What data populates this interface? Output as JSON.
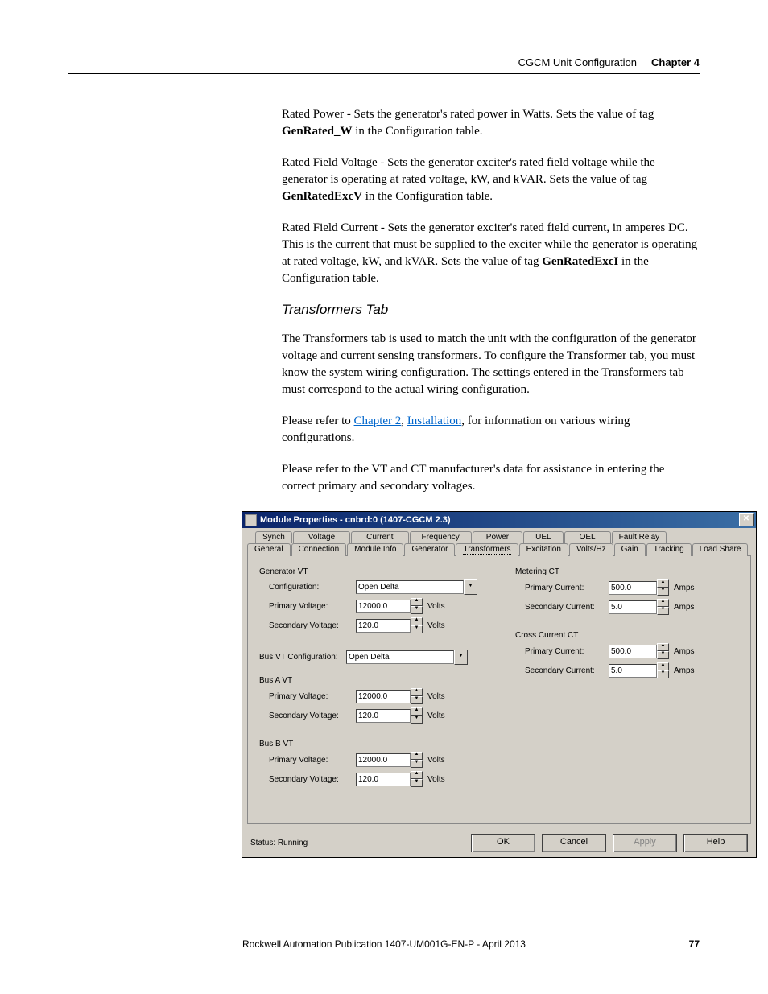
{
  "header": {
    "section": "CGCM Unit Configuration",
    "chapter": "Chapter 4"
  },
  "paragraphs": {
    "p1a": "Rated Power - Sets the generator's rated power in Watts. Sets the value of tag ",
    "p1b": "GenRated_W",
    "p1c": " in the Configuration table.",
    "p2a": "Rated Field Voltage - Sets the generator exciter's rated field voltage while the generator is operating at rated voltage, kW, and kVAR. Sets the value of tag ",
    "p2b": "GenRatedExcV",
    "p2c": " in the Configuration table.",
    "p3a": "Rated Field Current - Sets the generator exciter's rated field current, in amperes DC. This is the current that must be supplied to the exciter while the generator is operating at rated voltage, kW, and kVAR. Sets the value of tag ",
    "p3b": "GenRatedExcI",
    "p3c": " in the Configuration table.",
    "h3": "Transformers Tab",
    "p4": "The Transformers tab is used to match the unit with the configuration of the generator voltage and current sensing transformers. To configure the Transformer tab, you must know the system wiring configuration. The settings entered in the Transformers tab must correspond to the actual wiring configuration.",
    "p5a": "Please refer to ",
    "p5link1": "Chapter 2",
    "p5mid": ", ",
    "p5link2": "Installation",
    "p5b": ", for information on various wiring configurations.",
    "p6": "Please refer to the VT and CT manufacturer's data for assistance in entering the correct primary and secondary voltages."
  },
  "dialog": {
    "title": "Module Properties - cnbrd:0 (1407-CGCM 2.3)",
    "tabs_back": [
      "Synch",
      "Voltage",
      "Current",
      "Frequency",
      "Power",
      "UEL",
      "OEL",
      "Fault Relay"
    ],
    "tabs_front": [
      "General",
      "Connection",
      "Module Info",
      "Generator",
      "Transformers",
      "Excitation",
      "Volts/Hz",
      "Gain",
      "Tracking",
      "Load Share"
    ],
    "active_tab": "Transformers",
    "gen_vt_title": "Generator VT",
    "labels": {
      "configuration": "Configuration:",
      "primary_voltage": "Primary Voltage:",
      "secondary_voltage": "Secondary Voltage:",
      "bus_vt_config": "Bus VT Configuration:",
      "bus_a_vt": "Bus A VT",
      "bus_b_vt": "Bus B VT",
      "metering_ct": "Metering CT",
      "primary_current": "Primary Current:",
      "secondary_current": "Secondary Current:",
      "cross_current_ct": "Cross Current CT"
    },
    "values": {
      "gen_config": "Open Delta",
      "gen_primary_v": "12000.0",
      "gen_secondary_v": "120.0",
      "bus_vt_config": "Open Delta",
      "busA_primary_v": "12000.0",
      "busA_secondary_v": "120.0",
      "busB_primary_v": "12000.0",
      "busB_secondary_v": "120.0",
      "met_primary_i": "500.0",
      "met_secondary_i": "5.0",
      "cc_primary_i": "500.0",
      "cc_secondary_i": "5.0"
    },
    "units": {
      "volts": "Volts",
      "amps": "Amps"
    },
    "status_label": "Status: ",
    "status_value": "Running",
    "buttons": {
      "ok": "OK",
      "cancel": "Cancel",
      "apply": "Apply",
      "help": "Help"
    }
  },
  "footer": {
    "pub": "Rockwell Automation Publication 1407-UM001G-EN-P - April 2013",
    "page": "77"
  }
}
